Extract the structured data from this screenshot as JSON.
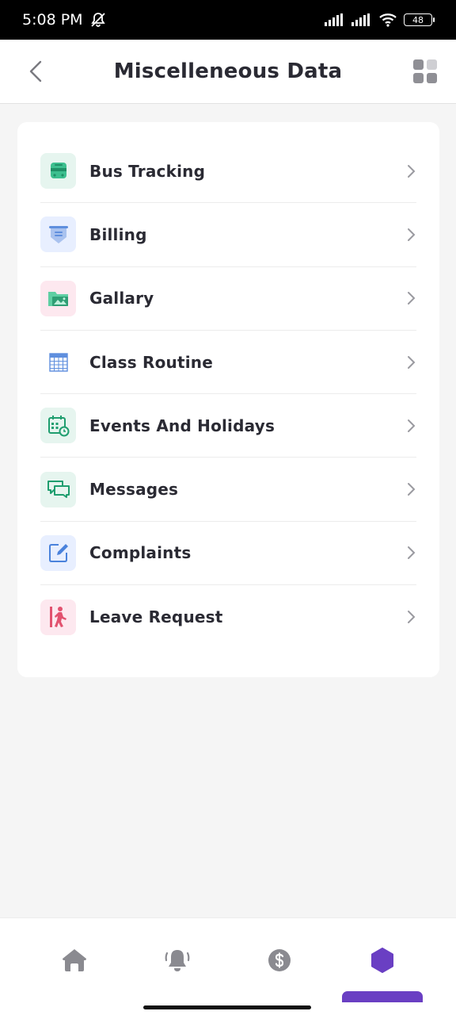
{
  "status_bar": {
    "time": "5:08 PM",
    "battery": "48"
  },
  "header": {
    "title": "Miscelleneous Data",
    "back_icon": "chevron-left-icon",
    "menu_icon": "grid-icon"
  },
  "menu": {
    "items": [
      {
        "label": "Bus Tracking",
        "icon": "bus-icon",
        "bg": "#e6f5ef"
      },
      {
        "label": "Billing",
        "icon": "bill-icon",
        "bg": "#e8efff"
      },
      {
        "label": "Gallary",
        "icon": "gallery-folder-icon",
        "bg": "#fde8ef"
      },
      {
        "label": "Class Routine",
        "icon": "calendar-grid-icon",
        "bg": "#ffffff"
      },
      {
        "label": "Events And Holidays",
        "icon": "calendar-clock-icon",
        "bg": "#e6f5ef"
      },
      {
        "label": "Messages",
        "icon": "chat-icon",
        "bg": "#e6f5ef"
      },
      {
        "label": "Complaints",
        "icon": "edit-icon",
        "bg": "#e8efff"
      },
      {
        "label": "Leave Request",
        "icon": "exit-person-icon",
        "bg": "#fde8ef"
      }
    ]
  },
  "bottom_nav": {
    "items": [
      {
        "icon": "home-icon"
      },
      {
        "icon": "bell-icon"
      },
      {
        "icon": "dollar-icon"
      },
      {
        "icon": "hexagon-icon",
        "active": true
      }
    ],
    "accent": "#6a3fc3"
  }
}
